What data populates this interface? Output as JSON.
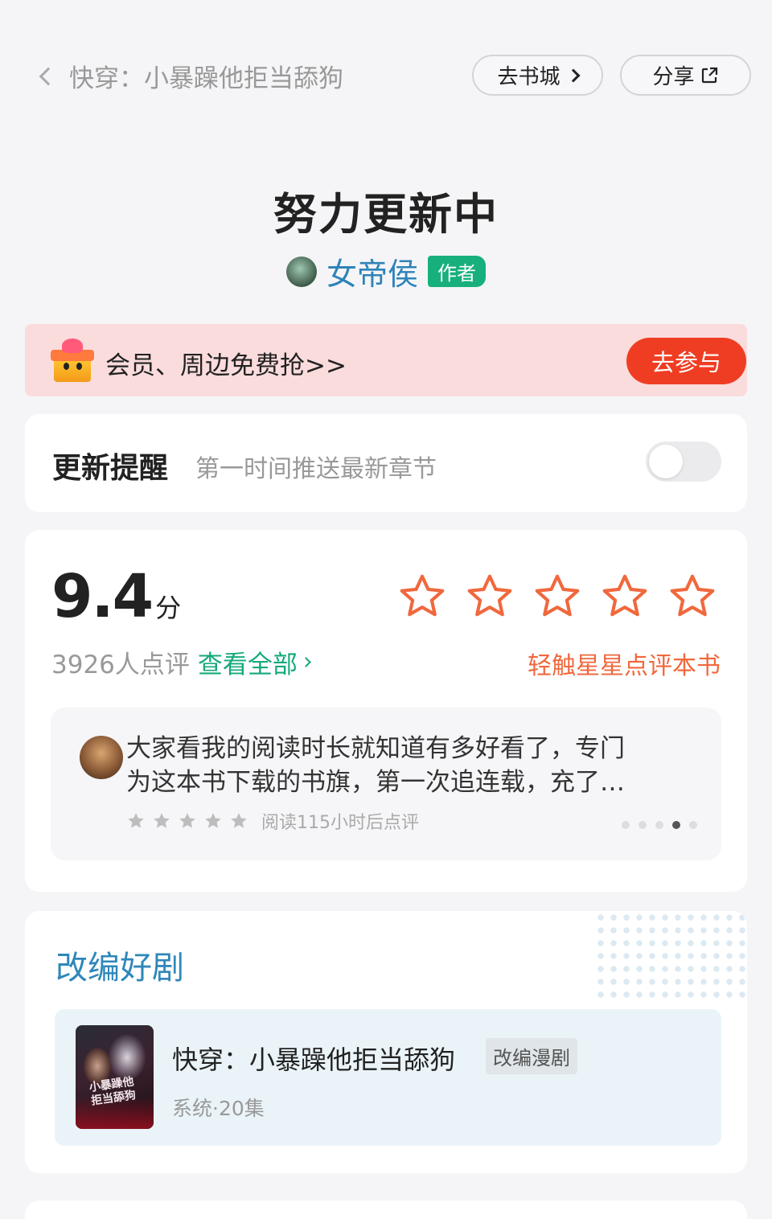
{
  "header": {
    "back_title": "快穿：小暴躁他拒当舔狗",
    "store_button": "去书城",
    "share_button": "分享"
  },
  "book": {
    "status": "努力更新中",
    "author_name": "女帝侯",
    "author_tag": "作者"
  },
  "promo": {
    "text": "会员、周边免费抢>>",
    "button": "去参与"
  },
  "reminder": {
    "title": "更新提醒",
    "subtitle": "第一时间推送最新章节",
    "enabled": false
  },
  "rating": {
    "score": "9.4",
    "unit": "分",
    "count": "3926人点评",
    "see_all": "查看全部",
    "tap_hint": "轻触星星点评本书",
    "star_color": "#f0683d",
    "review": {
      "line1": "大家看我的阅读时长就知道有多好看了，专门",
      "line2": "为这本书下载的书旗，第一次追连载，充了…",
      "stars": 5,
      "note": "阅读115小时后点评",
      "page_index": 4,
      "page_count": 5
    }
  },
  "drama": {
    "section_title": "改编好剧",
    "name": "快穿：小暴躁他拒当舔狗",
    "tag": "改编漫剧",
    "meta": "系统·20集",
    "poster_text_1": "小暴躁他",
    "poster_text_2": "拒当舔狗"
  },
  "colors": {
    "accent_green": "#15a97c",
    "accent_red": "#ef3d23",
    "link_blue": "#2f83b8"
  }
}
